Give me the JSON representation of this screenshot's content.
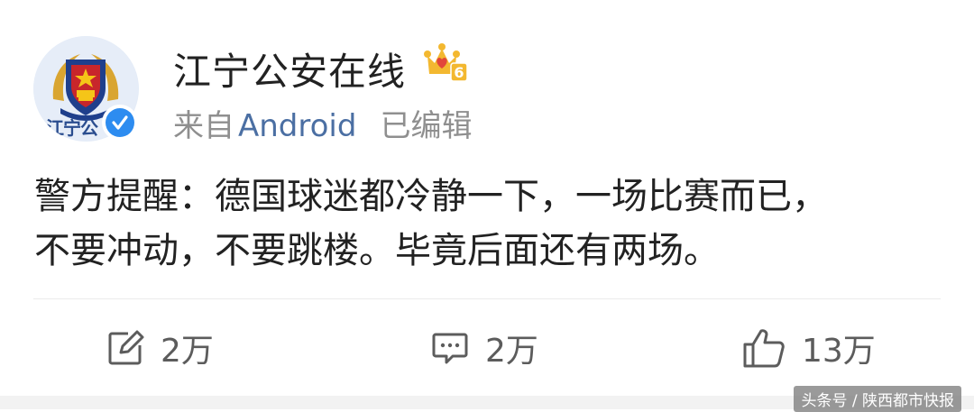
{
  "post": {
    "avatar_text": "江宁公",
    "username": "江宁公安在线",
    "vip_level": "6",
    "source_prefix": "来自",
    "source": "Android",
    "edited": "已编辑",
    "content_line1": "警方提醒：德国球迷都冷静一下，一场比赛而已，",
    "content_line2": "不要冲动，不要跳楼。毕竟后面还有两场。"
  },
  "actions": {
    "repost_count": "2万",
    "comment_count": "2万",
    "like_count": "13万"
  },
  "watermark": "头条号 / 陕西都市快报",
  "colors": {
    "accent_link": "#4b6fa3",
    "verified_blue": "#2d8cf0",
    "vip_gold": "#f3b830",
    "vip_red": "#e2463b"
  },
  "icons": {
    "repost": "repost-edit-icon",
    "comment": "comment-icon",
    "like": "thumbs-up-icon",
    "verified": "verified-check-icon",
    "vip": "vip-crown-icon"
  }
}
